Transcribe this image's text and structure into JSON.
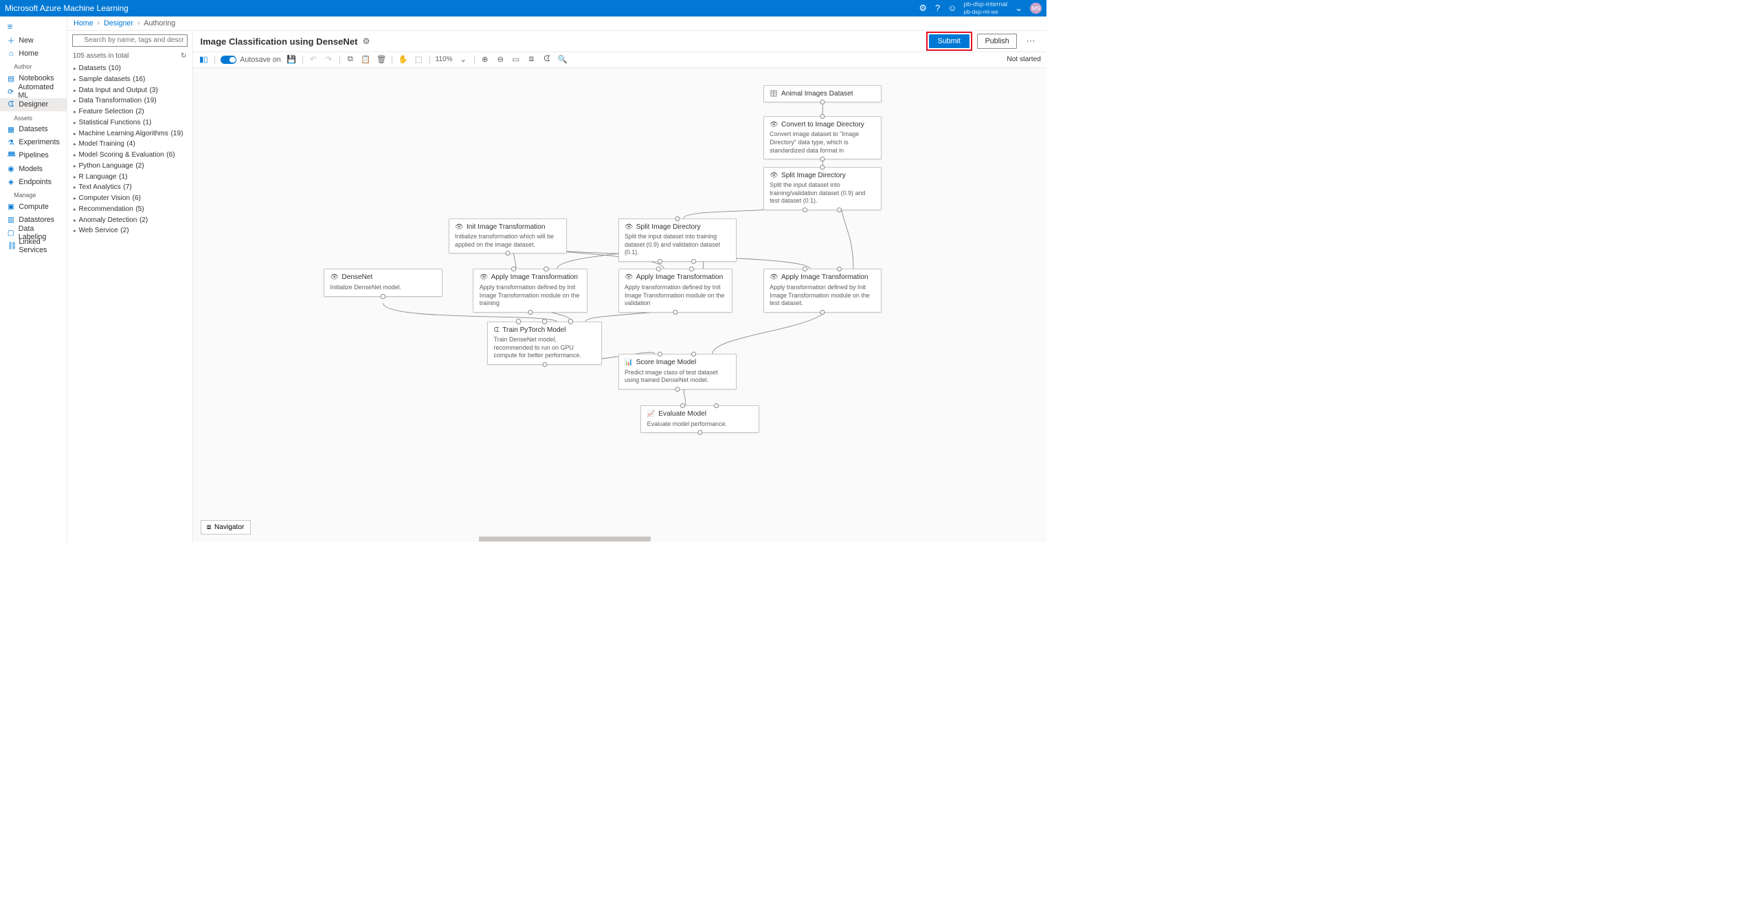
{
  "header": {
    "title": "Microsoft Azure Machine Learning",
    "workspace_name": "pb-dsp-internal",
    "workspace_sub": "pb-dsp-ml-ws",
    "avatar_initials": "MS"
  },
  "left_rail": {
    "new": "New",
    "home": "Home",
    "section_author": "Author",
    "notebooks": "Notebooks",
    "automated_ml": "Automated ML",
    "designer": "Designer",
    "section_assets": "Assets",
    "datasets": "Datasets",
    "experiments": "Experiments",
    "pipelines": "Pipelines",
    "models": "Models",
    "endpoints": "Endpoints",
    "section_manage": "Manage",
    "compute": "Compute",
    "datastores": "Datastores",
    "data_labeling": "Data Labeling",
    "linked_services": "Linked Services"
  },
  "breadcrumb": {
    "home": "Home",
    "designer": "Designer",
    "authoring": "Authoring"
  },
  "asset_panel": {
    "search_placeholder": "Search by name, tags and description",
    "total": "105 assets in total",
    "categories": [
      {
        "label": "Datasets",
        "count": "(10)"
      },
      {
        "label": "Sample datasets",
        "count": "(16)"
      },
      {
        "label": "Data Input and Output",
        "count": "(3)"
      },
      {
        "label": "Data Transformation",
        "count": "(19)"
      },
      {
        "label": "Feature Selection",
        "count": "(2)"
      },
      {
        "label": "Statistical Functions",
        "count": "(1)"
      },
      {
        "label": "Machine Learning Algorithms",
        "count": "(19)"
      },
      {
        "label": "Model Training",
        "count": "(4)"
      },
      {
        "label": "Model Scoring & Evaluation",
        "count": "(6)"
      },
      {
        "label": "Python Language",
        "count": "(2)"
      },
      {
        "label": "R Language",
        "count": "(1)"
      },
      {
        "label": "Text Analytics",
        "count": "(7)"
      },
      {
        "label": "Computer Vision",
        "count": "(6)"
      },
      {
        "label": "Recommendation",
        "count": "(5)"
      },
      {
        "label": "Anomaly Detection",
        "count": "(2)"
      },
      {
        "label": "Web Service",
        "count": "(2)"
      }
    ]
  },
  "canvas_header": {
    "title": "Image Classification using DenseNet",
    "submit": "Submit",
    "publish": "Publish"
  },
  "toolbar": {
    "autosave_label": "Autosave on",
    "zoom": "110%",
    "status": "Not started"
  },
  "nodes": {
    "n1": {
      "title": "Animal Images Dataset"
    },
    "n2": {
      "title": "Convert to Image Directory",
      "desc": "Convert image dataset to \"Image Directory\" data type, which is standardized data format in"
    },
    "n3": {
      "title": "Split Image Directory",
      "desc": "Split the input dataset into training/validation dataset (0.9) and test dataset (0.1)."
    },
    "n4": {
      "title": "Init Image Transformation",
      "desc": "Initialize transformation which will be applied on the image dataset."
    },
    "n5": {
      "title": "Split Image Directory",
      "desc": "Split the input dataset into training dataset (0.9) and validation dataset (0.1)."
    },
    "n6": {
      "title": "DenseNet",
      "desc": "Initialize DenseNet model."
    },
    "n7": {
      "title": "Apply Image Transformation",
      "desc": "Apply transformation defined by Init Image Transformation module on the training"
    },
    "n8": {
      "title": "Apply Image Transformation",
      "desc": "Apply transformation defined by Init Image Transformation module on the validation"
    },
    "n9": {
      "title": "Apply Image Transformation",
      "desc": "Apply transformation defined by Init Image Transformation module on the test dataset."
    },
    "n10": {
      "title": "Train PyTorch Model",
      "desc": "Train DenseNet model, recommended to run on GPU compute for better performance."
    },
    "n11": {
      "title": "Score Image Model",
      "desc": "Predict image class of test dataset using trained DenseNet model."
    },
    "n12": {
      "title": "Evaluate Model",
      "desc": "Evaluate model performance."
    }
  },
  "navigator": "Navigator"
}
